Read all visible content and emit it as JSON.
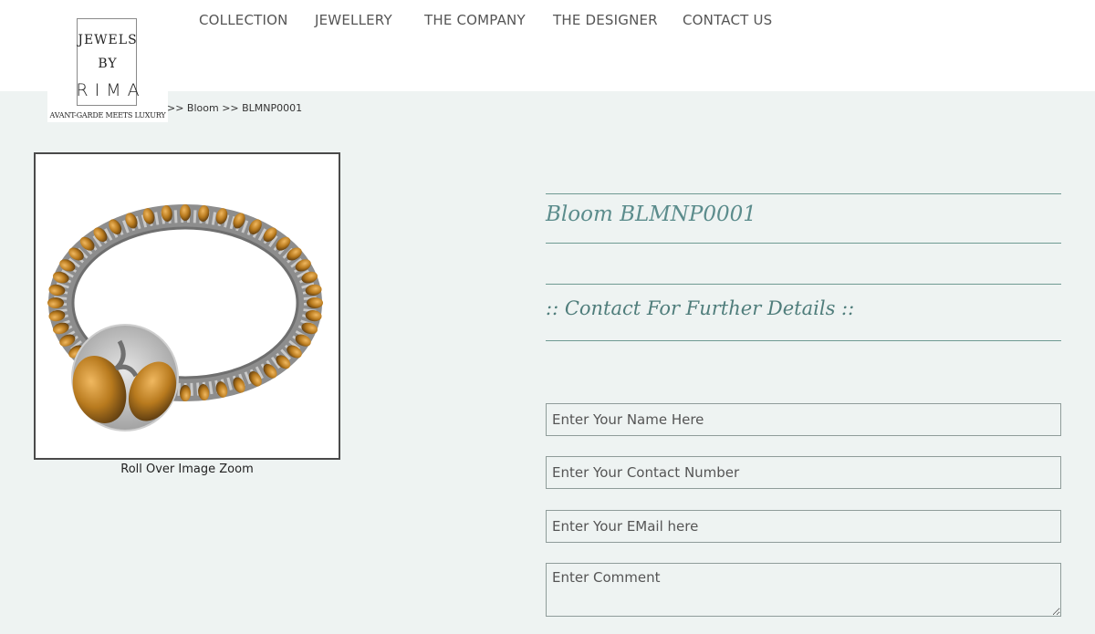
{
  "logo": {
    "line1": "JEWELS",
    "line2": "BY",
    "line3": "RIMA",
    "tagline": "AVANT-GARDE MEETS LUXURY"
  },
  "nav": [
    {
      "label": "COLLECTION"
    },
    {
      "label": "JEWELLERY"
    },
    {
      "label": "THE COMPANY"
    },
    {
      "label": "THE DESIGNER"
    },
    {
      "label": "CONTACT US"
    }
  ],
  "breadcrumb": ">> Bloom >> BLMNP0001",
  "product": {
    "caption": "Roll Over Image Zoom",
    "title": "Bloom BLMNP0001",
    "gem_color": "#b87a1e",
    "metal_color": "#9a9a9a"
  },
  "contact": {
    "heading": ":: Contact For Further Details ::",
    "name_placeholder": "Enter Your Name Here",
    "phone_placeholder": "Enter Your Contact Number",
    "email_placeholder": "Enter Your EMail here",
    "comment_placeholder": "Enter Comment"
  },
  "colors": {
    "accent": "#5b8c8c",
    "background": "#eef3f2"
  }
}
